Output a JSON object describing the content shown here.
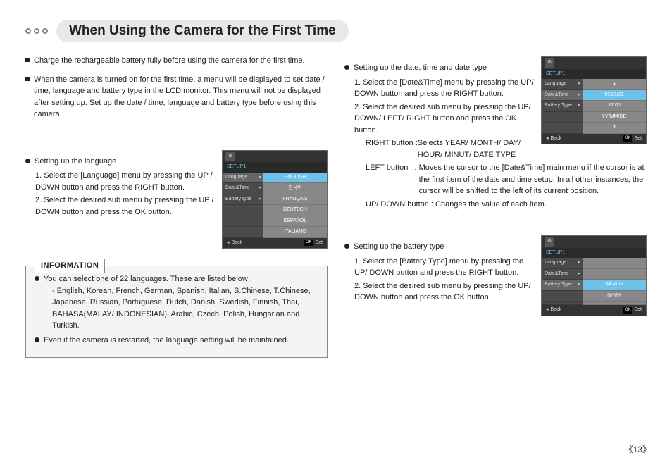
{
  "title": "When Using the Camera for the First Time",
  "left": {
    "p1": "Charge the rechargeable battery fully before using the camera for the first time.",
    "p2": "When the camera is turned on for the first time, a menu will be displayed to set date / time, language and battery type in the LCD monitor. This menu will not be displayed after setting up. Set up the date / time, language and battery type before using this camera.",
    "lang": {
      "heading": "Setting up the language",
      "s1": "1. Select the [Language] menu by pressing the UP / DOWN button and press the RIGHT button.",
      "s2": "2. Select the desired sub menu by pressing the UP / DOWN button and press the OK button."
    },
    "info": {
      "label": "INFORMATION",
      "i1": "You can select one of 22 languages. These are listed below :",
      "i1b": "- English, Korean, French, German, Spanish, Italian, S.Chinese, T.Chinese, Japanese, Russian, Portuguese, Dutch, Danish, Swedish, Finnish, Thai, BAHASA(MALAY/ INDONESIAN), Arabic, Czech, Polish, Hungarian and Turkish.",
      "i2": "Even if the camera is restarted, the language setting will be maintained."
    }
  },
  "right": {
    "dt": {
      "heading": "Setting up the date, time and date type",
      "s1": "1. Select the [Date&Time] menu by pressing the UP/ DOWN button and press the RIGHT button.",
      "s2": "2. Select the desired sub menu by pressing the UP/ DOWN/ LEFT/ RIGHT button and press the OK button.",
      "rb_label": "RIGHT button :",
      "rb": "Selects YEAR/ MONTH/ DAY/ HOUR/ MINUT/ DATE TYPE",
      "lb_label": "LEFT button   : ",
      "lb": "Moves the cursor to the [Date&Time] main menu if the cursor is at the first item of the date and time setup. In all other instances, the cursor will be shifted to the left of its current position.",
      "ud": "UP/ DOWN button : Changes the value of each item."
    },
    "bt": {
      "heading": "Setting up the battery type",
      "s1": "1. Select the [Battery Type] menu by pressing the UP/ DOWN button and press the RIGHT button.",
      "s2": "2. Select the desired sub menu by pressing the UP/ DOWN button and press the OK button."
    }
  },
  "lcd": {
    "setup": "SETUP1",
    "lang": "Language",
    "datetime": "Date&Time",
    "battype": "Battery type",
    "battype2": "Battery Type",
    "back": "Back",
    "ok": "OK",
    "set": "Set",
    "opts": {
      "english": "ENGLISH",
      "korean": "한국어",
      "francais": "FRANÇAIS",
      "deutsch": "DEUTSCH",
      "espanol": "ESPAÑOL",
      "italiano": "ITALIANO"
    },
    "date": "07/01/01",
    "time": "12:00",
    "fmt": "YY/MM/DD",
    "alkaline": "Alkaline",
    "nimh": "Ni-MH"
  },
  "page_number": "13"
}
